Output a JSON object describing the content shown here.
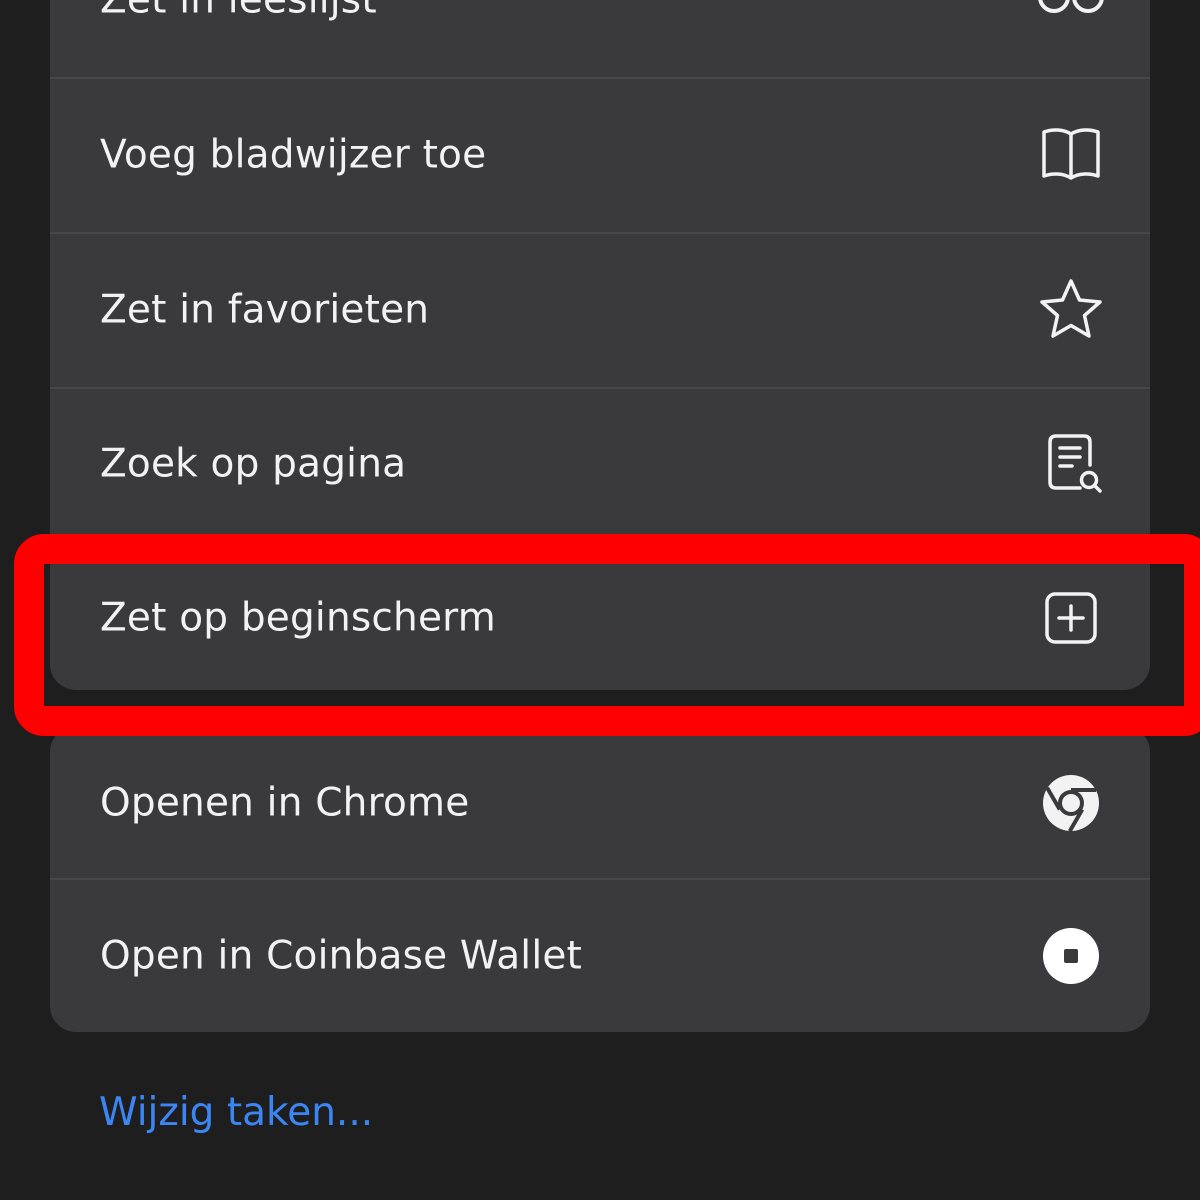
{
  "menu": {
    "items": [
      {
        "label": "Zet in leeslijst",
        "icon": "reading-glasses-icon"
      },
      {
        "label": "Voeg bladwijzer toe",
        "icon": "book-icon"
      },
      {
        "label": "Zet in favorieten",
        "icon": "star-icon"
      },
      {
        "label": "Zoek op pagina",
        "icon": "find-in-page-icon"
      },
      {
        "label": "Zet op beginscherm",
        "icon": "add-square-icon"
      }
    ],
    "app_items": [
      {
        "label": "Openen in Chrome",
        "icon": "chrome-icon"
      },
      {
        "label": "Open in Coinbase Wallet",
        "icon": "coinbase-wallet-icon"
      }
    ]
  },
  "edit_actions_label": "Wijzig taken...",
  "highlight": {
    "target": "Zet op beginscherm",
    "color": "#ff0000"
  },
  "colors": {
    "background": "#1e1e1f",
    "menu_surface": "#3a3a3c",
    "text": "#f2f2f2",
    "link": "#3c86f3"
  }
}
